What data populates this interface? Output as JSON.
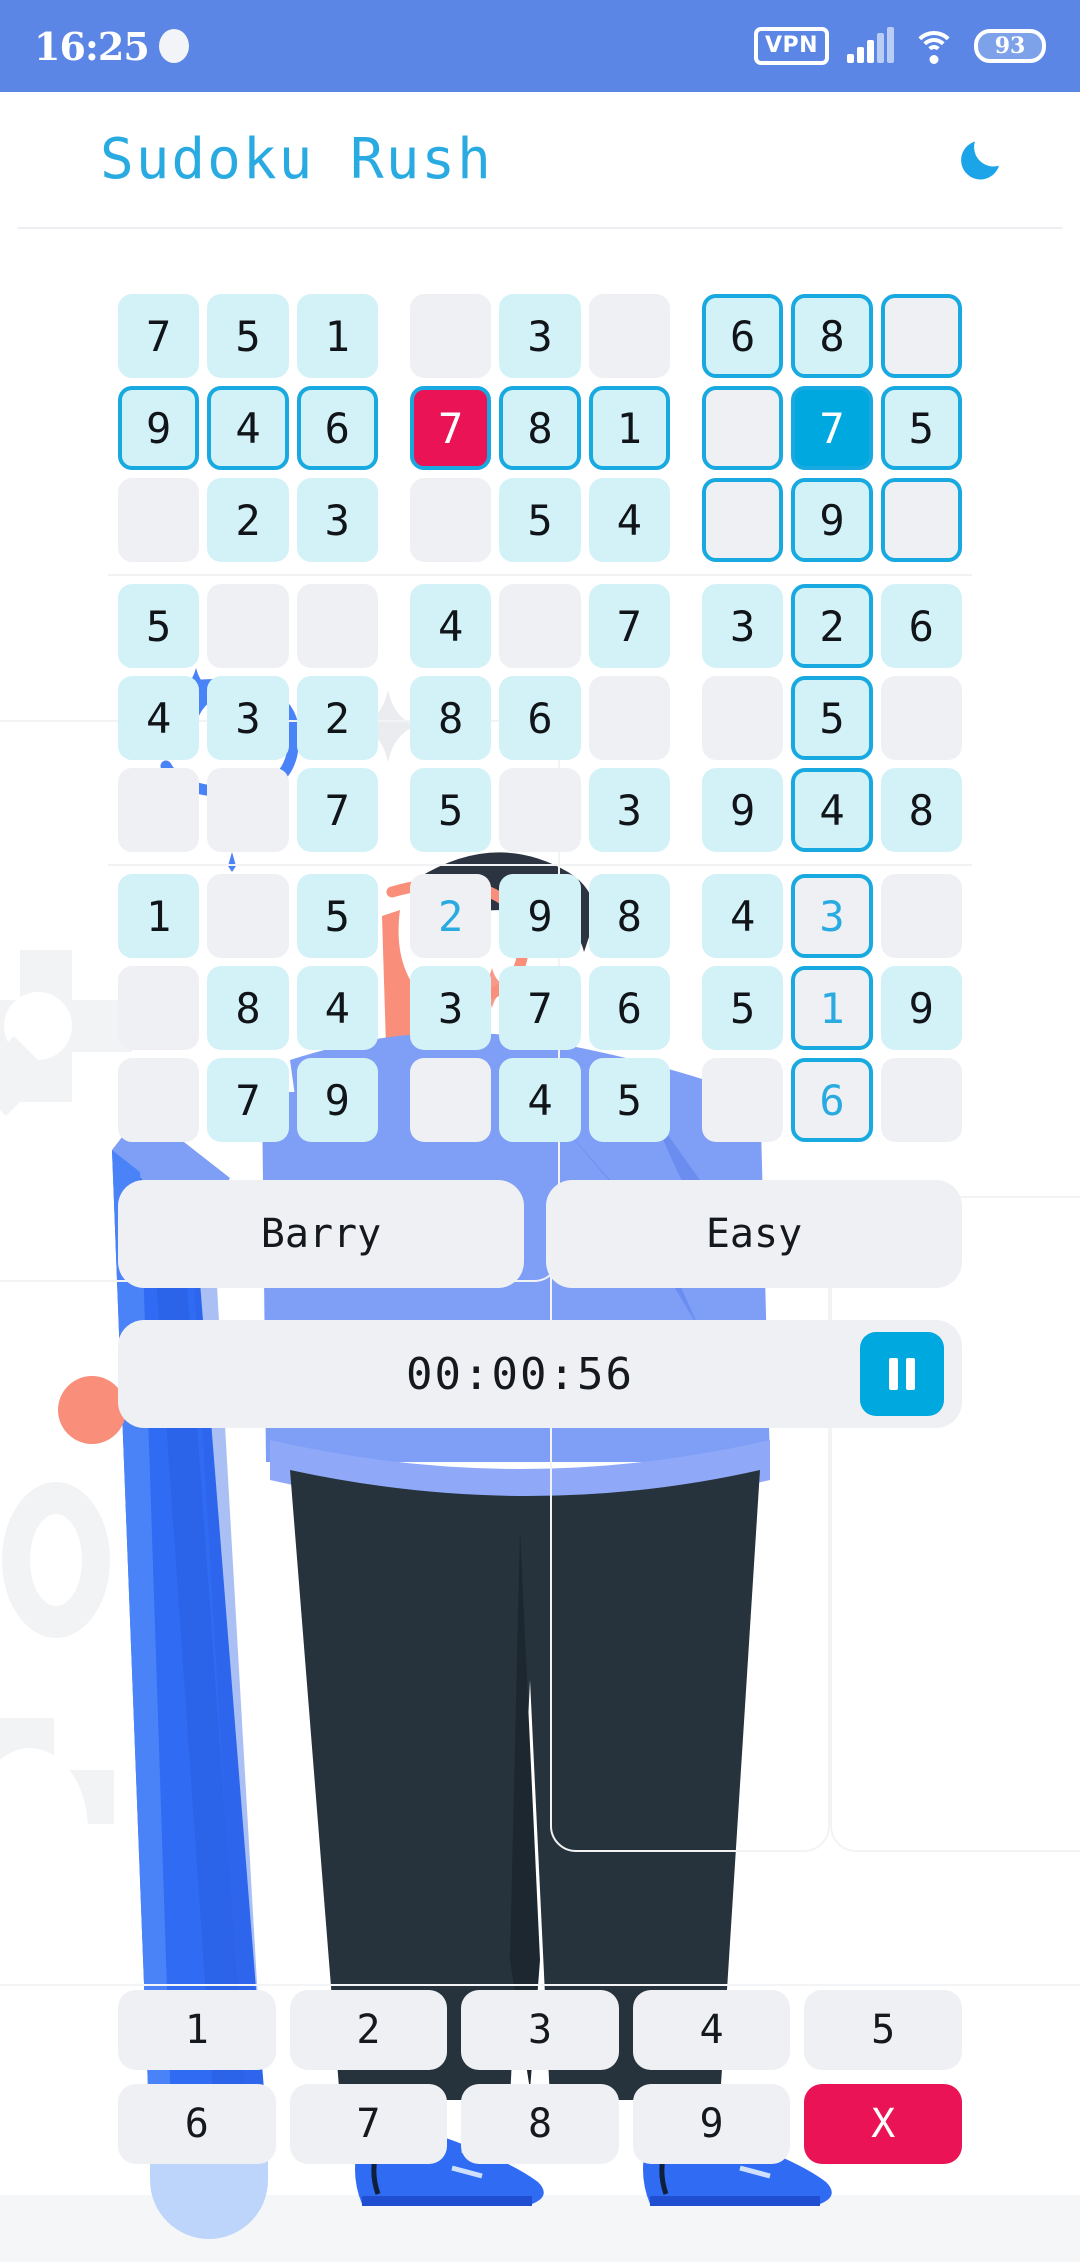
{
  "statusbar": {
    "time": "16:25",
    "vpn_label": "VPN",
    "battery": "93",
    "icons": [
      "camera-dot-icon",
      "vpn-icon",
      "signal-icon",
      "wifi-icon",
      "battery-icon"
    ]
  },
  "header": {
    "title": "Sudoku Rush",
    "dark_mode_icon": "moon-icon",
    "accent_color": "#29ABE2"
  },
  "board": {
    "selected_cell": {
      "row": 1,
      "col": 7,
      "value": "7"
    },
    "colors": {
      "given_bg": "#d2f2f7",
      "empty_bg": "#eff0f3",
      "selected_bg": "#00a8e0",
      "error_bg": "#ea1356",
      "highlight_border": "#17a9e0",
      "user_text": "#29ABE2"
    },
    "rows": [
      [
        {
          "v": "7",
          "s": "given"
        },
        {
          "v": "5",
          "s": "given"
        },
        {
          "v": "1",
          "s": "given"
        },
        {
          "v": "",
          "s": "empty"
        },
        {
          "v": "3",
          "s": "given"
        },
        {
          "v": "",
          "s": "empty"
        },
        {
          "v": "6",
          "s": "given-hl"
        },
        {
          "v": "8",
          "s": "given-hl"
        },
        {
          "v": "",
          "s": "empty-hl"
        }
      ],
      [
        {
          "v": "9",
          "s": "given-hl"
        },
        {
          "v": "4",
          "s": "given-hl"
        },
        {
          "v": "6",
          "s": "given-hl"
        },
        {
          "v": "7",
          "s": "error"
        },
        {
          "v": "8",
          "s": "given-hl"
        },
        {
          "v": "1",
          "s": "given-hl"
        },
        {
          "v": "",
          "s": "empty-hl"
        },
        {
          "v": "7",
          "s": "selected"
        },
        {
          "v": "5",
          "s": "given-hl"
        }
      ],
      [
        {
          "v": "",
          "s": "empty"
        },
        {
          "v": "2",
          "s": "given"
        },
        {
          "v": "3",
          "s": "given"
        },
        {
          "v": "",
          "s": "empty"
        },
        {
          "v": "5",
          "s": "given"
        },
        {
          "v": "4",
          "s": "given"
        },
        {
          "v": "",
          "s": "empty-hl"
        },
        {
          "v": "9",
          "s": "given-hl"
        },
        {
          "v": "",
          "s": "empty-hl"
        }
      ],
      [
        {
          "v": "5",
          "s": "given"
        },
        {
          "v": "",
          "s": "empty"
        },
        {
          "v": "",
          "s": "empty"
        },
        {
          "v": "4",
          "s": "given"
        },
        {
          "v": "",
          "s": "empty"
        },
        {
          "v": "7",
          "s": "given"
        },
        {
          "v": "3",
          "s": "given"
        },
        {
          "v": "2",
          "s": "given-hl"
        },
        {
          "v": "6",
          "s": "given"
        }
      ],
      [
        {
          "v": "4",
          "s": "given"
        },
        {
          "v": "3",
          "s": "given"
        },
        {
          "v": "2",
          "s": "given"
        },
        {
          "v": "8",
          "s": "given"
        },
        {
          "v": "6",
          "s": "given"
        },
        {
          "v": "",
          "s": "empty"
        },
        {
          "v": "",
          "s": "empty"
        },
        {
          "v": "5",
          "s": "given-hl"
        },
        {
          "v": "",
          "s": "empty"
        }
      ],
      [
        {
          "v": "",
          "s": "empty"
        },
        {
          "v": "",
          "s": "empty"
        },
        {
          "v": "7",
          "s": "given"
        },
        {
          "v": "5",
          "s": "given"
        },
        {
          "v": "",
          "s": "empty"
        },
        {
          "v": "3",
          "s": "given"
        },
        {
          "v": "9",
          "s": "given"
        },
        {
          "v": "4",
          "s": "given-hl"
        },
        {
          "v": "8",
          "s": "given"
        }
      ],
      [
        {
          "v": "1",
          "s": "given"
        },
        {
          "v": "",
          "s": "empty"
        },
        {
          "v": "5",
          "s": "given"
        },
        {
          "v": "2",
          "s": "user"
        },
        {
          "v": "9",
          "s": "given"
        },
        {
          "v": "8",
          "s": "given"
        },
        {
          "v": "4",
          "s": "given"
        },
        {
          "v": "3",
          "s": "user-hl"
        },
        {
          "v": "",
          "s": "empty"
        }
      ],
      [
        {
          "v": "",
          "s": "empty"
        },
        {
          "v": "8",
          "s": "given"
        },
        {
          "v": "4",
          "s": "given"
        },
        {
          "v": "3",
          "s": "given"
        },
        {
          "v": "7",
          "s": "given"
        },
        {
          "v": "6",
          "s": "given"
        },
        {
          "v": "5",
          "s": "given"
        },
        {
          "v": "1",
          "s": "user-hl"
        },
        {
          "v": "9",
          "s": "given"
        }
      ],
      [
        {
          "v": "",
          "s": "empty"
        },
        {
          "v": "7",
          "s": "given"
        },
        {
          "v": "9",
          "s": "given"
        },
        {
          "v": "",
          "s": "empty"
        },
        {
          "v": "4",
          "s": "given"
        },
        {
          "v": "5",
          "s": "given"
        },
        {
          "v": "",
          "s": "empty"
        },
        {
          "v": "6",
          "s": "user-hl"
        },
        {
          "v": "",
          "s": "empty"
        }
      ]
    ]
  },
  "info": {
    "player_name": "Barry",
    "difficulty": "Easy"
  },
  "timer": {
    "value": "00:00:56",
    "pause_icon": "pause-icon"
  },
  "keypad": {
    "row1": [
      "1",
      "2",
      "3",
      "4",
      "5"
    ],
    "row2": [
      "6",
      "7",
      "8",
      "9"
    ],
    "erase_label": "X"
  }
}
